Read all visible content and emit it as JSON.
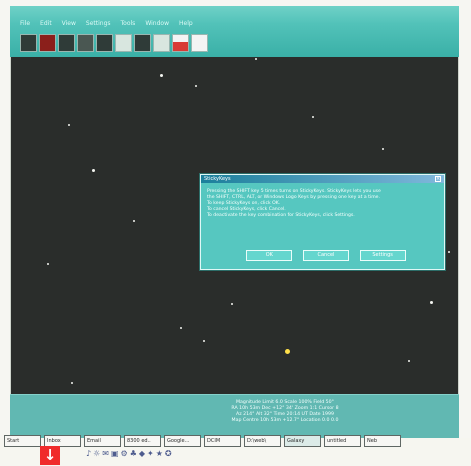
{
  "window": {
    "menu": [
      "File",
      "Edit",
      "View",
      "Settings",
      "Tools",
      "Window",
      "Help"
    ],
    "toolbar_icons": [
      "planet-icon",
      "moon-icon",
      "stars-icon",
      "constellation-icon",
      "telescope-icon",
      "galaxy-icon",
      "comet-icon",
      "sun-icon",
      "flag-icon",
      "document-icon"
    ]
  },
  "sky": {
    "status_lines": [
      "Magnitude Limit 6.0 Scale 100% Field 50°",
      "RA 10h 53m Dec +12° 34' Zoom 1:1 Cursor 8",
      "Az 214° Alt 32° Time 20:14 UT Date 1999",
      "Map Centre 10h 53m +12.7° Location 0.0 0.0"
    ]
  },
  "dialog": {
    "title": "StickyKeys",
    "body": [
      "Pressing the SHIFT key 5 times turns on StickyKeys. StickyKeys lets you use",
      "the SHIFT, CTRL, ALT, or Windows Logo Keys by pressing one key at a time.",
      "",
      "To keep StickyKeys on, click OK.",
      "To cancel StickyKeys, click Cancel.",
      "To deactivate the key combination for StickyKeys, click Settings."
    ],
    "buttons": {
      "ok": "OK",
      "cancel": "Cancel",
      "settings": "Settings"
    }
  },
  "taskbar": {
    "buttons": [
      "Start",
      "Inbox",
      "Email",
      "8300 ed..",
      "Google...",
      "DCIM",
      "D:\\web\\",
      "Galaxy",
      "untitled",
      "Neb"
    ],
    "tray_icons": "♪☼✉▣⚙♣◆✦★✪"
  }
}
